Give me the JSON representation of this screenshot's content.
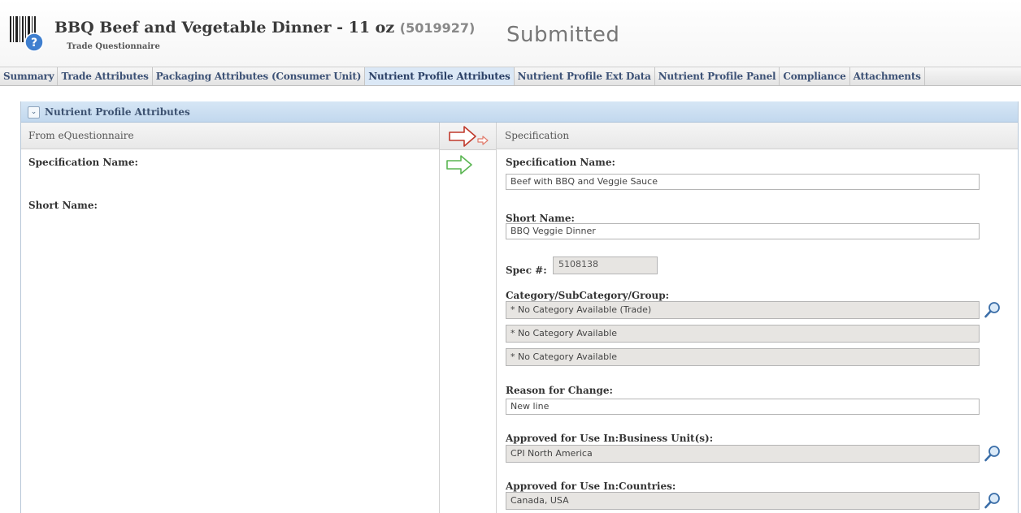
{
  "header": {
    "title": "BBQ Beef and Vegetable Dinner - 11 oz",
    "product_id": "(5019927)",
    "subtitle": "Trade Questionnaire",
    "status": "Submitted",
    "logo_icon": "barcode-help-icon"
  },
  "tabs": [
    {
      "label": "Summary",
      "active": false
    },
    {
      "label": "Trade Attributes",
      "active": false
    },
    {
      "label": "Packaging Attributes (Consumer Unit)",
      "active": false
    },
    {
      "label": "Nutrient Profile Attributes",
      "active": true
    },
    {
      "label": "Nutrient Profile Ext Data",
      "active": false
    },
    {
      "label": "Nutrient Profile Panel",
      "active": false
    },
    {
      "label": "Compliance",
      "active": false
    },
    {
      "label": "Attachments",
      "active": false
    }
  ],
  "panel": {
    "title": "Nutrient Profile Attributes",
    "collapse_icon": "chevron-down-icon",
    "left_header": "From eQuestionnaire",
    "right_header": "Specification",
    "copy_all_icon": "arrow-right-icon",
    "copy_field_icon": "arrow-right-icon",
    "left_fields": {
      "spec_name_label": "Specification Name:",
      "short_name_label": "Short Name:"
    },
    "right_fields": {
      "spec_name_label": "Specification Name:",
      "spec_name_value": "Beef with BBQ and Veggie Sauce",
      "short_name_label": "Short Name:",
      "short_name_value": "BBQ Veggie Dinner",
      "spec_num_label": "Spec #:",
      "spec_num_value": "5108138",
      "category_label": "Category/SubCategory/Group:",
      "category_values": [
        "* No Category Available (Trade)",
        "* No Category Available",
        "* No Category Available"
      ],
      "reason_label": "Reason for Change:",
      "reason_value": "New line",
      "business_units_label": "Approved for Use In:Business Unit(s):",
      "business_units_value": "CPI North America",
      "countries_label": "Approved for Use In:Countries:",
      "countries_value": "Canada, USA",
      "lookup_icon": "magnifier-icon"
    }
  },
  "colors": {
    "tab_text": "#3d5276",
    "active_tab_bg": "#dbe8f6",
    "panel_header_bg": "#c9ddf1",
    "arrow_red": "#c0392b",
    "arrow_green": "#5ab552",
    "readonly_bg": "#e7e5e2"
  }
}
